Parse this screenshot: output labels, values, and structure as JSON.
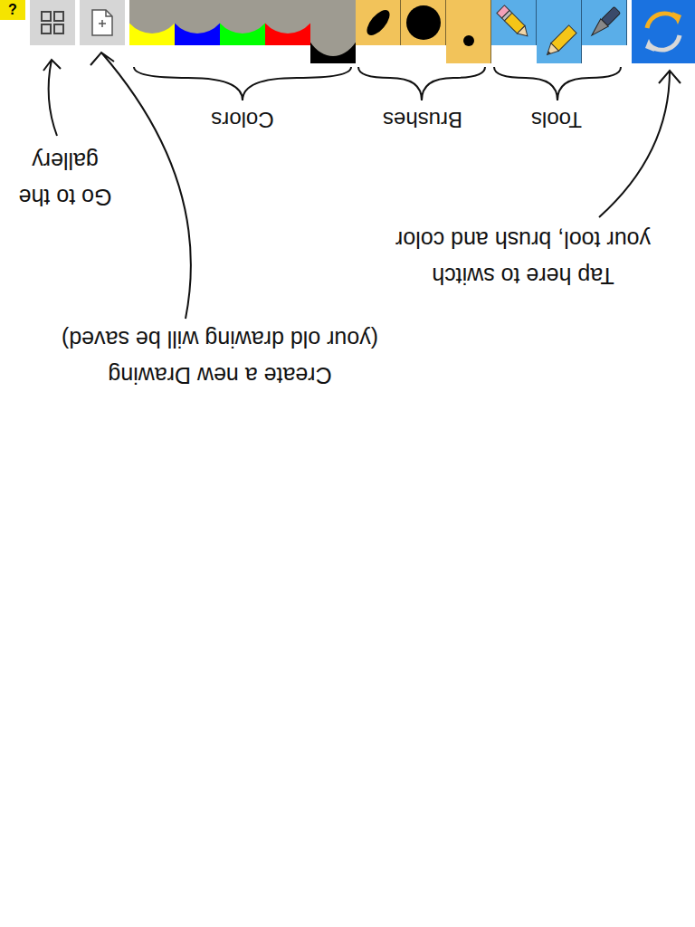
{
  "help_button": {
    "label": "?"
  },
  "toolbar": {
    "colors": [
      {
        "selected": false,
        "color": "#ffff00"
      },
      {
        "selected": false,
        "color": "#0000ff"
      },
      {
        "selected": false,
        "color": "#00ff00"
      },
      {
        "selected": false,
        "color": "#ff0000"
      },
      {
        "selected": true,
        "color": "#000000"
      }
    ],
    "brushes": [
      {
        "kind": "oval",
        "selected": false
      },
      {
        "kind": "large",
        "selected": false
      },
      {
        "kind": "small",
        "selected": true
      }
    ],
    "tools": [
      {
        "kind": "eraser-pencil",
        "selected": false
      },
      {
        "kind": "pencil",
        "selected": true
      },
      {
        "kind": "pen",
        "selected": false
      }
    ]
  },
  "group_labels": {
    "colors": "Colors",
    "brushes": "Brushes",
    "tools": "Tools"
  },
  "annotations": {
    "gallery": [
      "Go to the",
      "gallery"
    ],
    "new_drawing": [
      "Create a new Drawing",
      "(your old drawing will be saved)"
    ],
    "switch": [
      "Tap here to switch",
      "your tool, brush and color"
    ]
  }
}
